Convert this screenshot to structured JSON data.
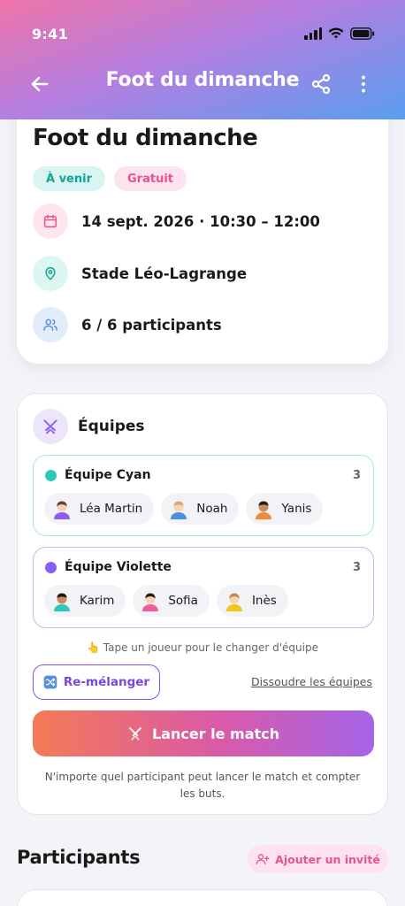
{
  "status_bar": {
    "time": "9:41"
  },
  "nav": {
    "title": "Foot du dimanche"
  },
  "event": {
    "title": "Foot du dimanche",
    "badges": {
      "upcoming": "À venir",
      "free": "Gratuit"
    },
    "date": "14 sept. 2026 · 10:30 – 12:00",
    "location": "Stade Léo-Lagrange",
    "participants": "6 / 6 participants"
  },
  "teams": {
    "title": "Équipes",
    "team_a": {
      "name": "Équipe Cyan",
      "count": "3",
      "color": "#2ec8b8",
      "players": [
        "Léa Martin",
        "Noah",
        "Yanis"
      ]
    },
    "team_b": {
      "name": "Équipe Violette",
      "count": "3",
      "color": "#8b5cf6",
      "players": [
        "Karim",
        "Sofia",
        "Inès"
      ]
    },
    "hint": "👆 Tape un joueur pour le changer d'équipe",
    "reshuffle_label": "Re-mélanger",
    "dissolve_label": "Dissoudre les équipes",
    "launch_label": "Lancer le match",
    "launch_note": "N'importe quel participant peut lancer le match et compter les buts."
  },
  "participants_section": {
    "title": "Participants",
    "add_guest_label": "Ajouter un invité"
  },
  "colors": {
    "accent_pink": "#e9538e",
    "accent_violet": "#7a45e0",
    "accent_teal": "#17a394"
  }
}
